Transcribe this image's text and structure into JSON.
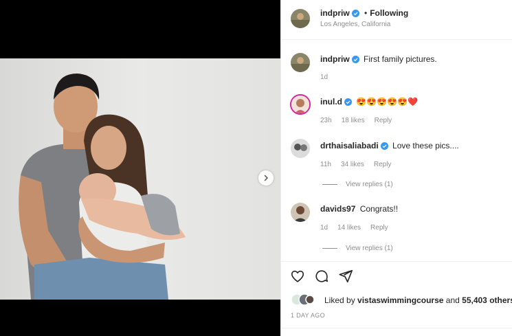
{
  "post": {
    "author": "indpriw",
    "follow_separator": "•",
    "follow_status": "Following",
    "location": "Los Angeles, California",
    "caption": "First family pictures.",
    "caption_age": "1d"
  },
  "comments": [
    {
      "user": "inul.d",
      "verified": true,
      "text": "😍😍😍😍😍❤️",
      "age": "23h",
      "likes": "18 likes",
      "reply": "Reply"
    },
    {
      "user": "drthaisaliabadi",
      "verified": true,
      "text": "Love these pics....",
      "age": "11h",
      "likes": "34 likes",
      "reply": "Reply",
      "view_replies": "View replies (1)"
    },
    {
      "user": "davids97",
      "verified": false,
      "text": "Congrats!!",
      "age": "1d",
      "likes": "14 likes",
      "reply": "Reply",
      "view_replies": "View replies (1)"
    }
  ],
  "likes": {
    "prefix": "Liked by",
    "user": "vistaswimmingcourse",
    "and": "and",
    "others": "55,403 others"
  },
  "timestamp": "1 DAY AGO",
  "colors": {
    "verified": "#3897f0",
    "muted": "#8e8e8e",
    "text": "#262626"
  },
  "icons": [
    "heart-icon",
    "comment-icon",
    "share-icon",
    "chevron-right-icon",
    "verified-badge-icon"
  ]
}
